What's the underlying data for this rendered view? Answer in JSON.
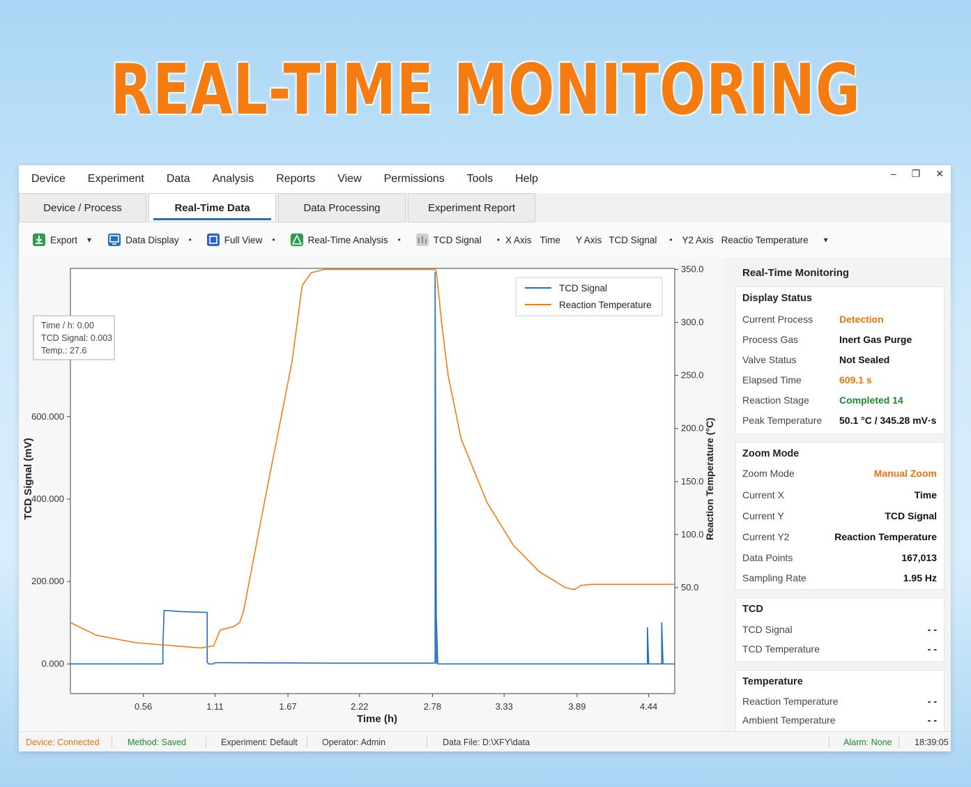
{
  "banner": "REAL-TIME MONITORING",
  "menu": [
    "Device",
    "Experiment",
    "Data",
    "Analysis",
    "Reports",
    "View",
    "Permissions",
    "Tools",
    "Help"
  ],
  "window_controls": {
    "minimize": "–",
    "restore": "❐",
    "close": "✕"
  },
  "tabs": [
    "Device / Process",
    "Real-Time Data",
    "Data Processing",
    "Experiment Report"
  ],
  "active_tab": 1,
  "toolbar": {
    "export": "Export",
    "data_display": "Data Display",
    "full_view": "Full View",
    "realtime_analysis": "Real-Time Analysis",
    "tcd_signal": "TCD Signal",
    "x_axis_label": "X Axis",
    "x_axis_value": "Time",
    "y_axis_label": "Y Axis",
    "y_axis_value": "TCD Signal",
    "y2_axis_label": "Y2 Axis",
    "y2_axis_value": "Reactio Temperature",
    "dropdown_arrow": "▾",
    "bullet": "•"
  },
  "tooltip": {
    "time": "Time / h: 0.00",
    "tcd": "TCD Signal: 0.003",
    "temp": "Temp.: 27.6"
  },
  "chart_data": {
    "type": "line",
    "xlabel": "Time (h)",
    "ylabel": "TCD Signal (mV)",
    "y2label": "Reaction Temperature (°C)",
    "x_ticks": [
      "0.56",
      "1.11",
      "1.67",
      "2.22",
      "2.78",
      "3.33",
      "3.89",
      "4.44"
    ],
    "x_tick_values": [
      0.56,
      1.11,
      1.67,
      2.22,
      2.78,
      3.33,
      3.89,
      4.44
    ],
    "y_ticks": [
      "0.000",
      "200.000",
      "400.000",
      "600.000"
    ],
    "y_tick_values": [
      0,
      200,
      400,
      600
    ],
    "y2_ticks": [
      "50.0",
      "100.0",
      "150.0",
      "200.0",
      "250.0",
      "300.0",
      "350.0"
    ],
    "y2_tick_values": [
      50,
      100,
      150,
      200,
      250,
      300,
      350
    ],
    "xlim": [
      0.0,
      4.64
    ],
    "ylim": [
      -72,
      960
    ],
    "y2lim": [
      -50,
      351
    ],
    "legend_position": "top-right",
    "series": [
      {
        "name": "TCD Signal",
        "axis": "y",
        "color": "#1f6fc4",
        "x": [
          0.0,
          0.71,
          0.71,
          0.72,
          0.85,
          1.05,
          1.05,
          1.06,
          1.1,
          1.11,
          1.2,
          2.0,
          2.8,
          2.8,
          2.81,
          2.81,
          2.82,
          2.82,
          2.83,
          3.5,
          4.43,
          4.43,
          4.44,
          4.44,
          4.54,
          4.54,
          4.55,
          4.55,
          4.64
        ],
        "y": [
          0,
          0,
          50,
          130,
          127,
          125,
          5,
          0,
          0,
          3,
          3,
          2,
          2,
          950,
          2,
          110,
          2,
          0,
          0,
          0,
          0,
          88,
          0,
          0,
          0,
          100,
          0,
          0,
          0
        ]
      },
      {
        "name": "Reaction Temperature",
        "axis": "y2",
        "color": "#f57c10",
        "x": [
          0.0,
          0.2,
          0.5,
          0.8,
          1.0,
          1.1,
          1.15,
          1.25,
          1.3,
          1.33,
          1.5,
          1.7,
          1.78,
          1.85,
          1.95,
          2.2,
          2.6,
          2.8,
          2.81,
          2.85,
          2.9,
          3.0,
          3.2,
          3.4,
          3.6,
          3.8,
          3.87,
          3.92,
          4.0,
          4.3,
          4.64
        ],
        "y": [
          17,
          5,
          -2,
          -5,
          -7,
          -5,
          10,
          13,
          17,
          28,
          137,
          262,
          335,
          347,
          350,
          350,
          350,
          350,
          348,
          300,
          250,
          190,
          130,
          90,
          65,
          50,
          48,
          52,
          53,
          53,
          53
        ]
      }
    ]
  },
  "side": {
    "title": "Real-Time Monitoring",
    "display_status": {
      "title": "Display Status",
      "rows": [
        {
          "k": "Current Process",
          "v": "Detection"
        },
        {
          "k": "Process Gas",
          "v": "Inert Gas Purge"
        },
        {
          "k": "Valve Status",
          "v": "Not Sealed"
        },
        {
          "k": "Elapsed Time",
          "v": "609.1 s"
        },
        {
          "k": "Reaction Stage",
          "v": "Completed 14"
        },
        {
          "k": "Peak Temperature",
          "v": "50.1 °C / 345.28 mV·s"
        }
      ]
    },
    "zoom": {
      "title": "Zoom Mode",
      "rows": [
        {
          "k": "Zoom Mode",
          "v": "Manual Zoom"
        },
        {
          "k": "Current X",
          "v": "Time"
        },
        {
          "k": "Current Y",
          "v": "TCD Signal"
        },
        {
          "k": "Current Y2",
          "v": "Reaction Temperature"
        },
        {
          "k": "Data Points",
          "v": "167,013"
        },
        {
          "k": "Sampling Rate",
          "v": "1.95  Hz"
        }
      ]
    },
    "tcd": {
      "title": "TCD",
      "rows": [
        {
          "k": "TCD Signal",
          "v": "- -"
        },
        {
          "k": "TCD Temperature",
          "v": "- -"
        }
      ]
    },
    "temperature": {
      "title": "Temperature",
      "rows": [
        {
          "k": "Reaction Temperature",
          "v": "- -"
        },
        {
          "k": "Ambient Temperature",
          "v": "- -"
        }
      ]
    }
  },
  "status": {
    "device": "Device:  Connected",
    "method": "Method:  Saved",
    "experiment": "Experiment:  Default",
    "operator": "Operator: Admin",
    "data_file": "Data File:   D:\\XFY\\data",
    "alarm": "Alarm: None",
    "time": "18:39:05"
  },
  "colors": {
    "accent": "#1f6fc4",
    "orange": "#e8740c",
    "green": "#1a8a2a",
    "banner": "#f57c10"
  }
}
